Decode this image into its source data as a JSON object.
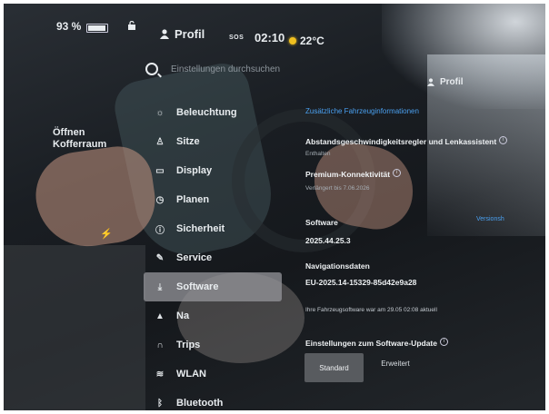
{
  "status": {
    "battery_percent": "93 %",
    "battery_level": 0.93,
    "profile": "Profil",
    "sos": "SOS",
    "time": "02:10",
    "temperature": "22°C"
  },
  "trunk": {
    "line1": "Öffnen",
    "line2": "Kofferraum"
  },
  "search": {
    "placeholder": "Einstellungen durchsuchen"
  },
  "profile_right": "Profil",
  "sidebar": {
    "items": [
      {
        "label": "Beleuchtung",
        "icon": "light-icon"
      },
      {
        "label": "Sitze",
        "icon": "seat-icon"
      },
      {
        "label": "Display",
        "icon": "display-icon"
      },
      {
        "label": "Planen",
        "icon": "clock-icon"
      },
      {
        "label": "Sicherheit",
        "icon": "info-icon"
      },
      {
        "label": "Service",
        "icon": "wrench-icon"
      },
      {
        "label": "Software",
        "icon": "download-icon",
        "active": true
      },
      {
        "label": "Na",
        "icon": "navigation-icon"
      },
      {
        "label": "Trips",
        "icon": "trips-icon"
      },
      {
        "label": "WLAN",
        "icon": "wifi-icon"
      },
      {
        "label": "Bluetooth",
        "icon": "bluetooth-icon"
      }
    ]
  },
  "content": {
    "additional_info_link": "Zusätzliche Fahrzeuginformationen",
    "feature1_title": "Abstandsgeschwindigkeitsregler und Lenkassistent",
    "feature1_sub": "Enthalten",
    "feature2_title": "Premium-Konnektivität",
    "feature2_sub": "Verlängert bis 7.06.2026",
    "software_label": "Software",
    "software_version": "2025.44.25.3",
    "nav_label": "Navigationsdaten",
    "nav_version": "EU-2025.14-15329-85d42e9a28",
    "update_status": "Ihre Fahrzeugsoftware war am 29.05 02:08 aktuell",
    "update_settings": "Einstellungen zum Software-Update",
    "btn_standard": "Standard",
    "btn_erweitert": "Erweitert",
    "versions_link": "Versionsh"
  },
  "colors": {
    "accent": "#4aa0f0",
    "sun": "#f0c020"
  }
}
